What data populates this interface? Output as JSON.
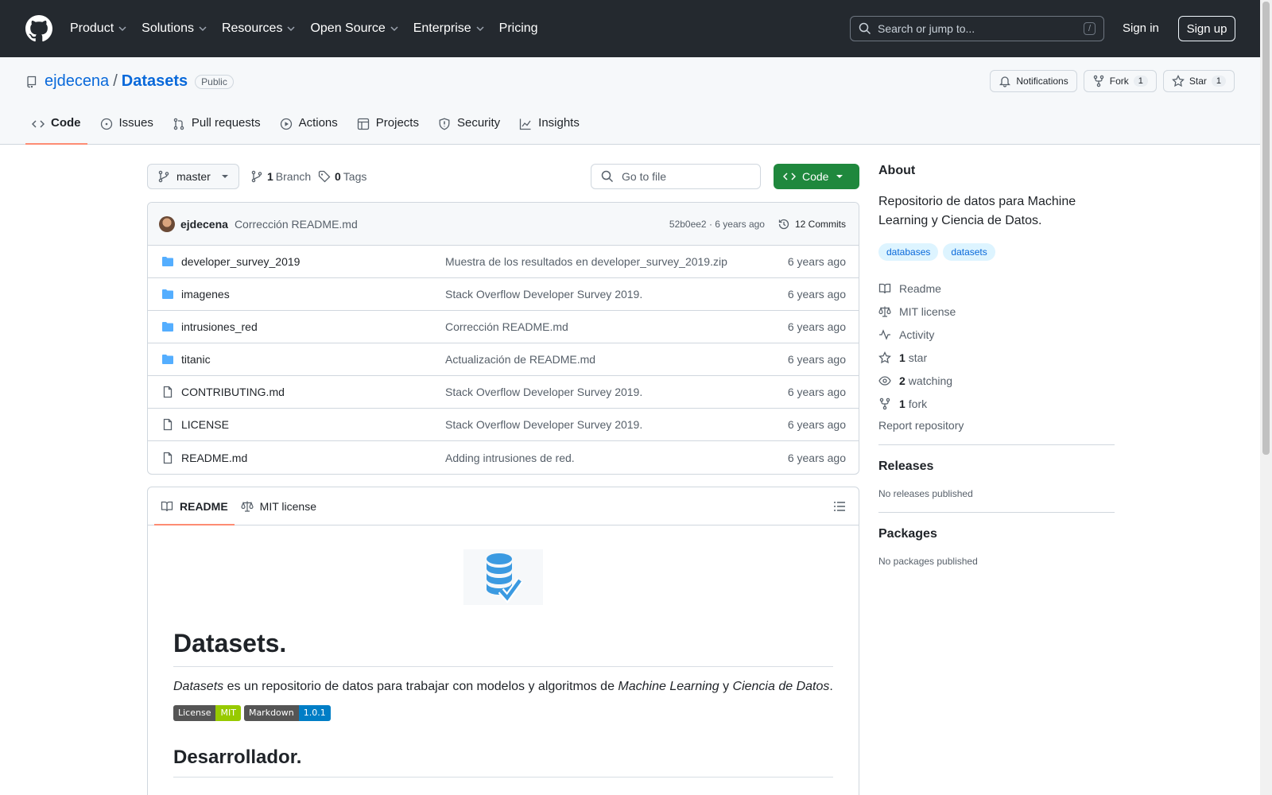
{
  "header": {
    "nav": [
      "Product",
      "Solutions",
      "Resources",
      "Open Source",
      "Enterprise",
      "Pricing"
    ],
    "search_placeholder": "Search or jump to...",
    "search_shortcut": "/",
    "signin": "Sign in",
    "signup": "Sign up"
  },
  "repo": {
    "owner": "ejdecena",
    "separator": "/",
    "name": "Datasets",
    "visibility": "Public",
    "notifications": "Notifications",
    "fork_label": "Fork",
    "fork_count": "1",
    "star_label": "Star",
    "star_count": "1"
  },
  "tabs": [
    "Code",
    "Issues",
    "Pull requests",
    "Actions",
    "Projects",
    "Security",
    "Insights"
  ],
  "branch_bar": {
    "branch": "master",
    "branch_count": "1",
    "branch_label": "Branch",
    "tag_count": "0",
    "tag_label": "Tags",
    "goto_placeholder": "Go to file",
    "code_label": "Code"
  },
  "commit": {
    "author": "ejdecena",
    "message": "Corrección README.md",
    "meta": "52b0ee2 · 6 years ago",
    "count": "12 Commits"
  },
  "files": [
    {
      "type": "dir",
      "name": "developer_survey_2019",
      "message": "Muestra de los resultados en developer_survey_2019.zip",
      "time": "6 years ago"
    },
    {
      "type": "dir",
      "name": "imagenes",
      "message": "Stack Overflow Developer Survey 2019.",
      "time": "6 years ago"
    },
    {
      "type": "dir",
      "name": "intrusiones_red",
      "message": "Corrección README.md",
      "time": "6 years ago"
    },
    {
      "type": "dir",
      "name": "titanic",
      "message": "Actualización de README.md",
      "time": "6 years ago"
    },
    {
      "type": "file",
      "name": "CONTRIBUTING.md",
      "message": "Stack Overflow Developer Survey 2019.",
      "time": "6 years ago"
    },
    {
      "type": "file",
      "name": "LICENSE",
      "message": "Stack Overflow Developer Survey 2019.",
      "time": "6 years ago"
    },
    {
      "type": "file",
      "name": "README.md",
      "message": "Adding intrusiones de red.",
      "time": "6 years ago"
    }
  ],
  "readme": {
    "tab_readme": "README",
    "tab_license": "MIT license",
    "h1": "Datasets.",
    "intro_em1": "Datasets",
    "intro_t1": " es un repositorio de datos para trabajar con modelos y algoritmos de ",
    "intro_em2": "Machine Learning",
    "intro_t2": " y ",
    "intro_em3": "Ciencia de Datos",
    "intro_t3": ".",
    "badge1_left": "License",
    "badge1_right": "MIT",
    "badge2_left": "Markdown",
    "badge2_right": "1.0.1",
    "h2": "Desarrollador."
  },
  "about": {
    "title": "About",
    "description": "Repositorio de datos para Machine Learning y Ciencia de Datos.",
    "topics": [
      "databases",
      "datasets"
    ],
    "readme": "Readme",
    "license": "MIT license",
    "activity": "Activity",
    "stars_count": "1",
    "stars_label": "star",
    "watching_count": "2",
    "watching_label": "watching",
    "forks_count": "1",
    "forks_label": "fork",
    "report": "Report repository"
  },
  "releases": {
    "title": "Releases",
    "empty": "No releases published"
  },
  "packages": {
    "title": "Packages",
    "empty": "No packages published"
  }
}
